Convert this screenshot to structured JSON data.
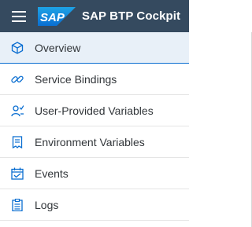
{
  "header": {
    "logo_text": "SAP",
    "product_title": "SAP BTP Cockpit",
    "brand_color": "#0a6ed1",
    "bar_color": "#354a5f"
  },
  "nav": {
    "items": [
      {
        "label": "Overview",
        "icon": "cube-icon",
        "selected": true
      },
      {
        "label": "Service Bindings",
        "icon": "chain-link-icon",
        "selected": false
      },
      {
        "label": "User-Provided Variables",
        "icon": "user-edit-icon",
        "selected": false
      },
      {
        "label": "Environment Variables",
        "icon": "document-icon",
        "selected": false
      },
      {
        "label": "Events",
        "icon": "calendar-icon",
        "selected": false
      },
      {
        "label": "Logs",
        "icon": "clipboard-list-icon",
        "selected": false
      }
    ]
  }
}
